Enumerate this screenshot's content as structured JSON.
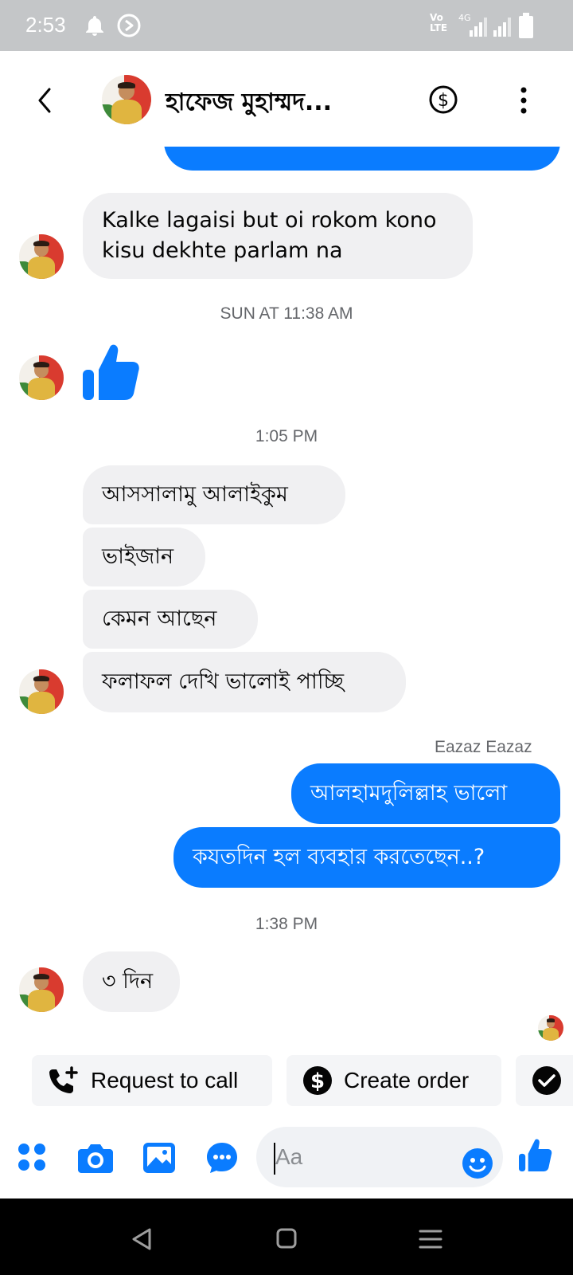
{
  "status_bar": {
    "time": "2:53",
    "network": "4G",
    "volte_line1": "Vo",
    "volte_line2": "LTE"
  },
  "header": {
    "contact_name": "হাফেজ মুহাম্মদ...",
    "back_icon": "chevron-left-icon",
    "payment_icon": "dollar-circle-icon",
    "menu_icon": "more-vertical-icon"
  },
  "messages": [
    {
      "type": "in",
      "text_line1": "Kalke lagaisi but oi rokom kono",
      "text_line2": "kisu dekhte parlam na"
    },
    {
      "type": "timestamp",
      "text": "SUN AT 11:38 AM"
    },
    {
      "type": "in_like",
      "icon": "thumbs-up-icon"
    },
    {
      "type": "timestamp",
      "text": "1:05 PM"
    },
    {
      "type": "in",
      "text": "আসসালামু আলাইকুম"
    },
    {
      "type": "in",
      "text": "ভাইজান"
    },
    {
      "type": "in",
      "text": "কেমন আছেন"
    },
    {
      "type": "in",
      "text": "ফলাফল দেখি ভালোই পাচ্ছি"
    },
    {
      "type": "sender",
      "text": "Eazaz Eazaz"
    },
    {
      "type": "out",
      "text": "আলহামদুলিল্লাহ ভালো"
    },
    {
      "type": "out",
      "text": "কযতদিন হল ব্যবহার করতেছেন..?"
    },
    {
      "type": "timestamp",
      "text": "1:38 PM"
    },
    {
      "type": "in",
      "text": "৩ দিন"
    }
  ],
  "quick_actions": [
    {
      "label": "Request to call",
      "icon": "phone-plus-icon"
    },
    {
      "label": "Create order",
      "icon": "dollar-circle-icon"
    },
    {
      "label": "",
      "icon": "check-circle-icon"
    }
  ],
  "composer": {
    "placeholder": "Aa",
    "icons": [
      "grid-icon",
      "camera-icon",
      "image-icon",
      "chat-more-icon",
      "emoji-icon",
      "thumbs-up-icon"
    ]
  },
  "colors": {
    "accent": "#0a7cff",
    "incoming_bubble": "#f0f0f2",
    "status_bar": "#c4c6c8",
    "nav_bar": "#000000",
    "meta_text": "#65676b"
  }
}
